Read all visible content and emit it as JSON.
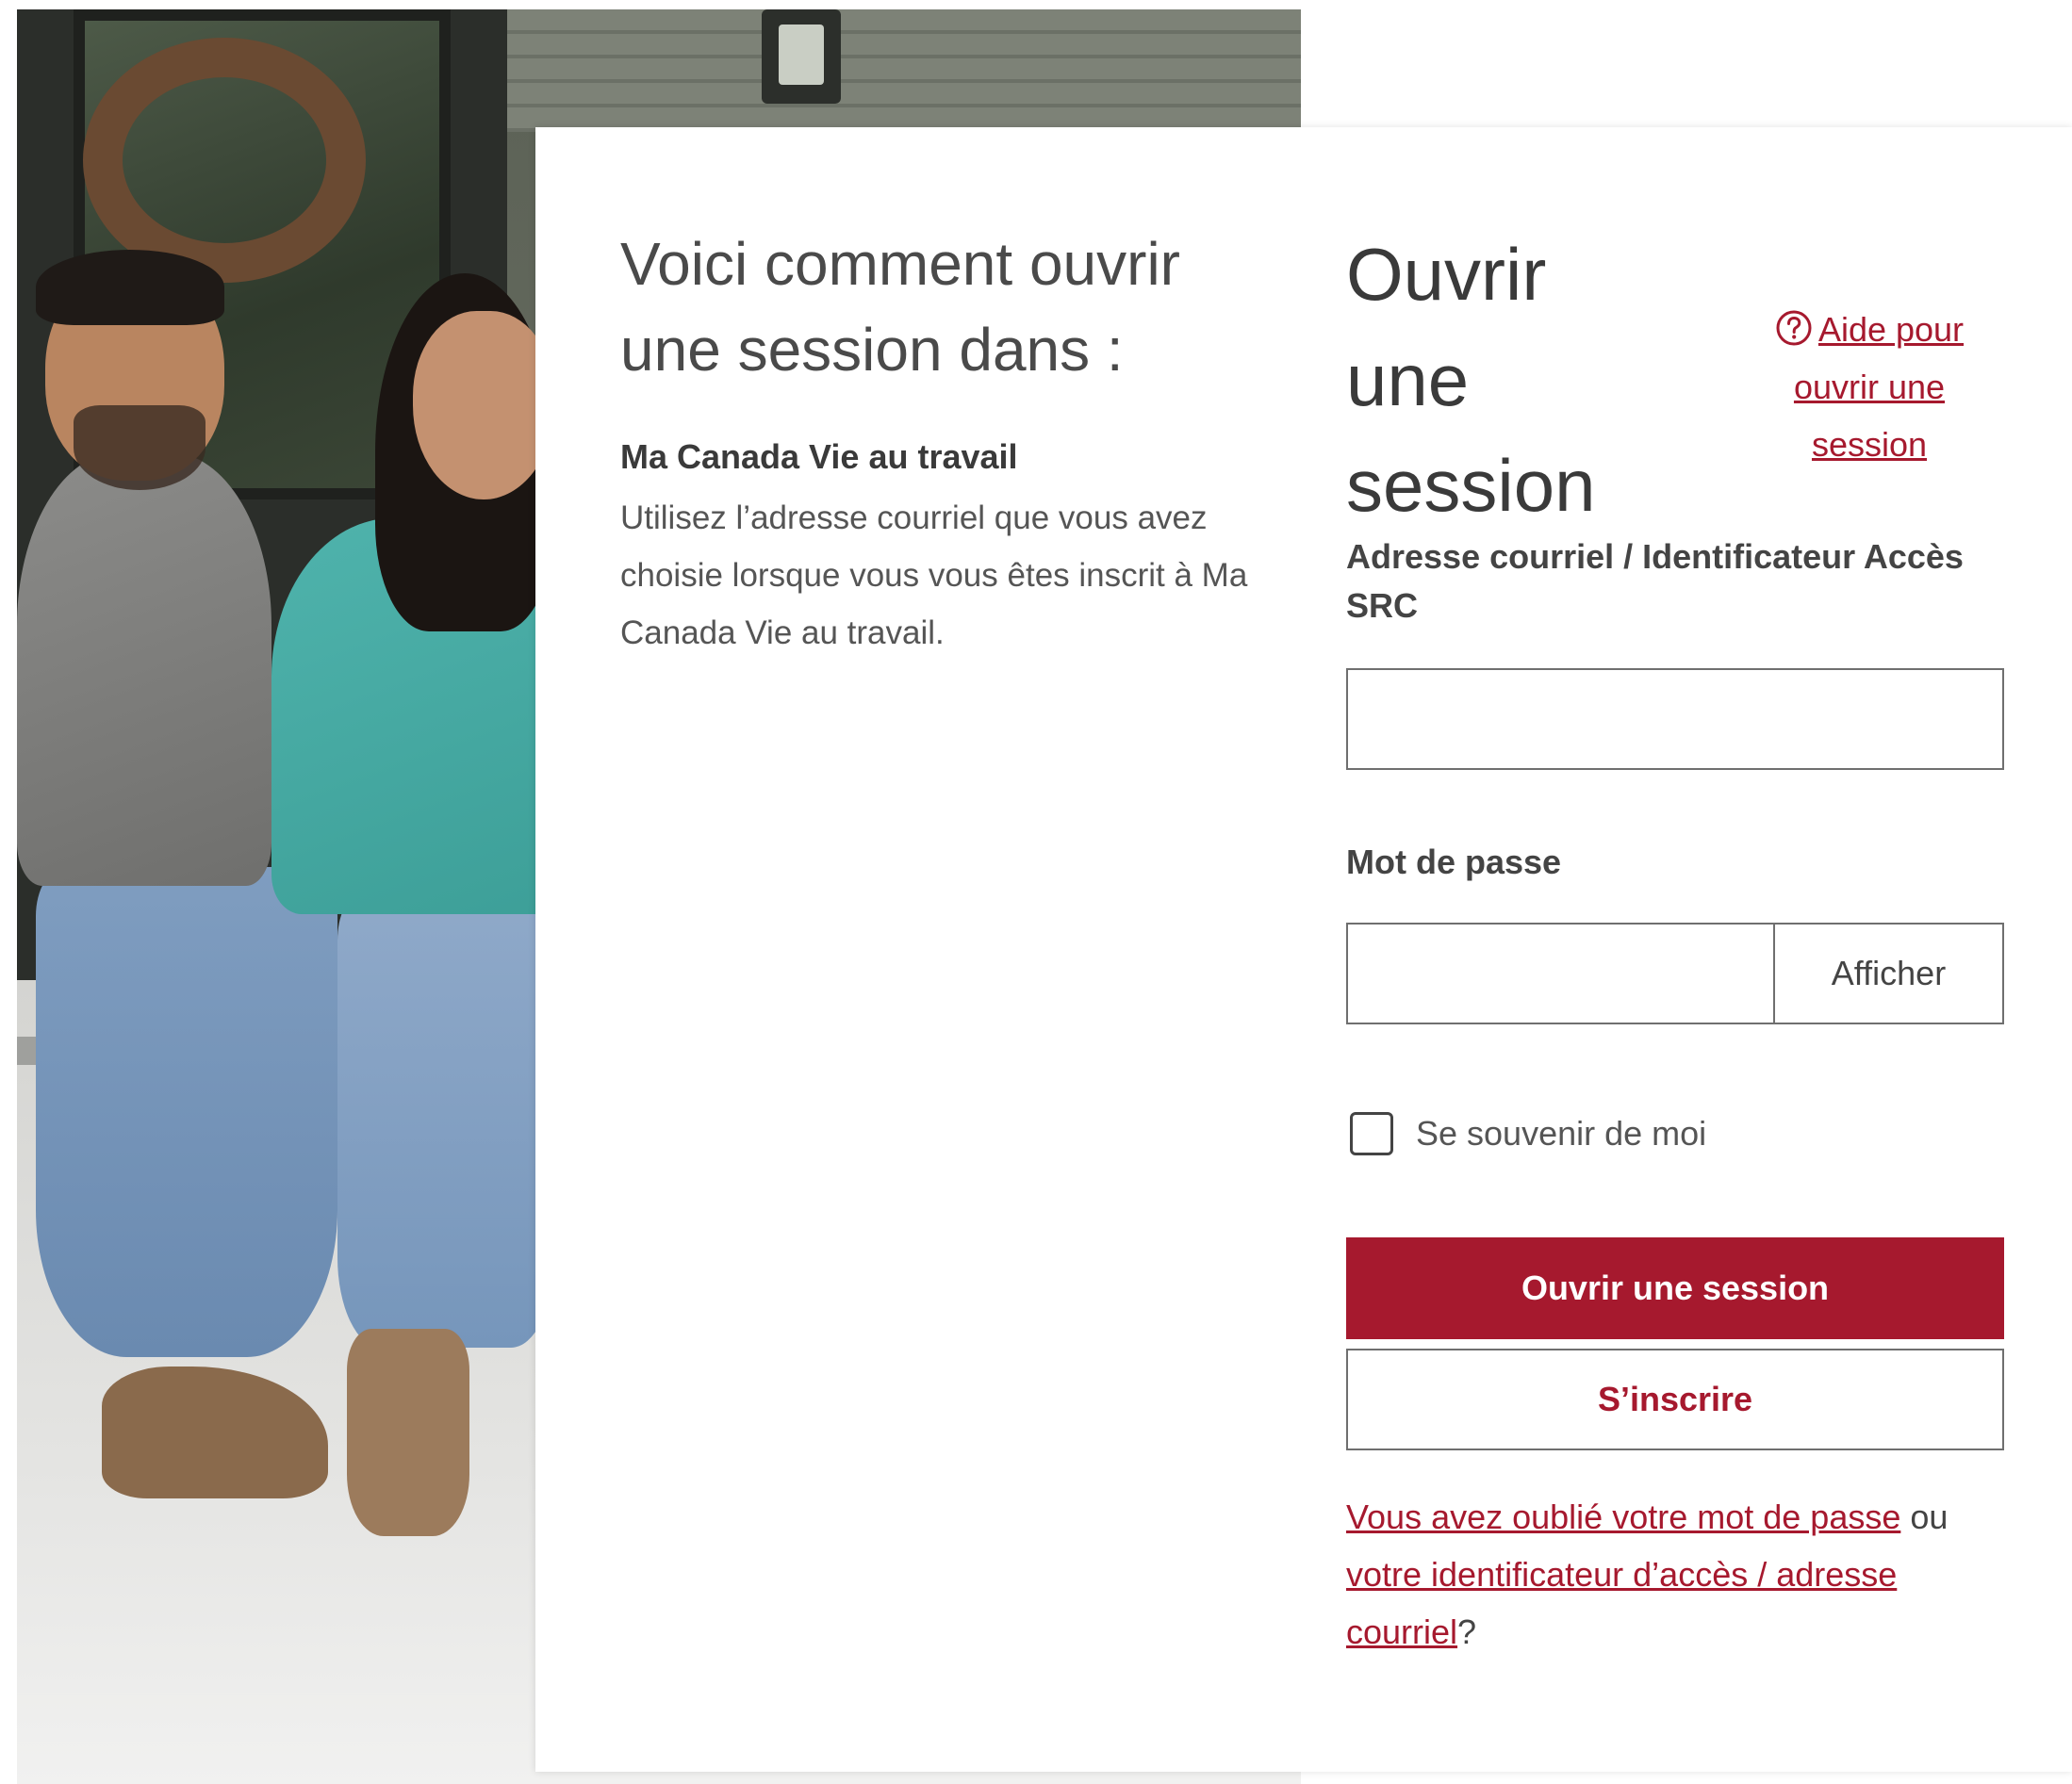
{
  "intro": {
    "title": "Voici comment ouvrir une session dans :",
    "subheading": "Ma Canada Vie au travail",
    "text": "Utilisez l’adresse courriel que vous avez choisie lorsque vous vous êtes inscrit à Ma Canada Vie au travail."
  },
  "login": {
    "title": "Ouvrir une session",
    "help_link": "Aide pour ouvrir une session",
    "help_icon": "question-circle-icon",
    "email_label": "Adresse courriel / Identificateur Accès SRC",
    "email_value": "",
    "password_label": "Mot de passe",
    "password_value": "",
    "show_label": "Afficher",
    "remember_label": "Se souvenir de moi",
    "submit_label": "Ouvrir une session",
    "register_label": "S’inscrire",
    "forgot": {
      "password_link": "Vous avez oublié votre mot de passe",
      "or": " ou ",
      "id_link": "votre identificateur d’accès / adresse courriel",
      "end": "?"
    }
  },
  "colors": {
    "accent": "#a6192e",
    "text": "#333333",
    "border": "#6f6f6f"
  }
}
